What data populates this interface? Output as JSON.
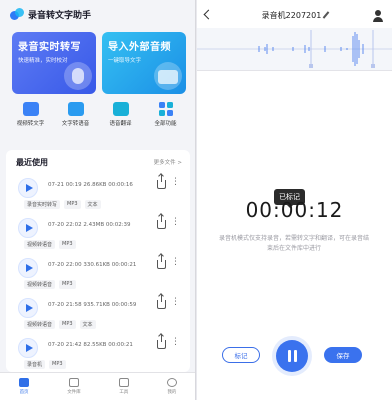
{
  "left": {
    "app_title": "录音转文字助手",
    "cards": [
      {
        "title": "录音实时转写",
        "subtitle": "快速精准，实时校对"
      },
      {
        "title": "导入外部音频",
        "subtitle": "一键取导文字"
      }
    ],
    "tools": [
      {
        "label": "视频转文字",
        "icon": "video-to-text-icon"
      },
      {
        "label": "文字转语音",
        "icon": "text-to-speech-icon"
      },
      {
        "label": "语音翻译",
        "icon": "voice-translate-icon"
      },
      {
        "label": "全部功能",
        "icon": "grid-icon"
      }
    ],
    "recent": {
      "title": "最近使用",
      "more": "更多文件 >",
      "items": [
        {
          "meta": "07-21 00:19  26.86KB  00:00:16",
          "tags": [
            "录音实时转写",
            "MP3",
            "文本"
          ]
        },
        {
          "meta": "07-20 22:02  2.43MB  00:02:39",
          "tags": [
            "视频转语音",
            "MP3"
          ]
        },
        {
          "meta": "07-20 22:00  330.61KB  00:00:21",
          "tags": [
            "视频转语音",
            "MP3"
          ]
        },
        {
          "meta": "07-20 21:58  935.71KB  00:00:59",
          "tags": [
            "视频转语音",
            "MP3",
            "文本"
          ]
        },
        {
          "meta": "07-20 21:42  82.55KB  00:00:21",
          "tags": [
            "录音机",
            "MP3"
          ]
        }
      ]
    },
    "tabs": [
      {
        "label": "首页",
        "active": true
      },
      {
        "label": "文件库",
        "active": false
      },
      {
        "label": "工具",
        "active": false
      },
      {
        "label": "我的",
        "active": false
      }
    ]
  },
  "right": {
    "title": "录音机2207201",
    "timer": "00:00:12",
    "tooltip": "已标记",
    "hint": "录音机模式仅支持录音，若需转文字和翻译，可在录音结束后在文件库中进行",
    "mark_button": "标记",
    "save_button": "保存",
    "accent_color": "#3a72ee"
  }
}
